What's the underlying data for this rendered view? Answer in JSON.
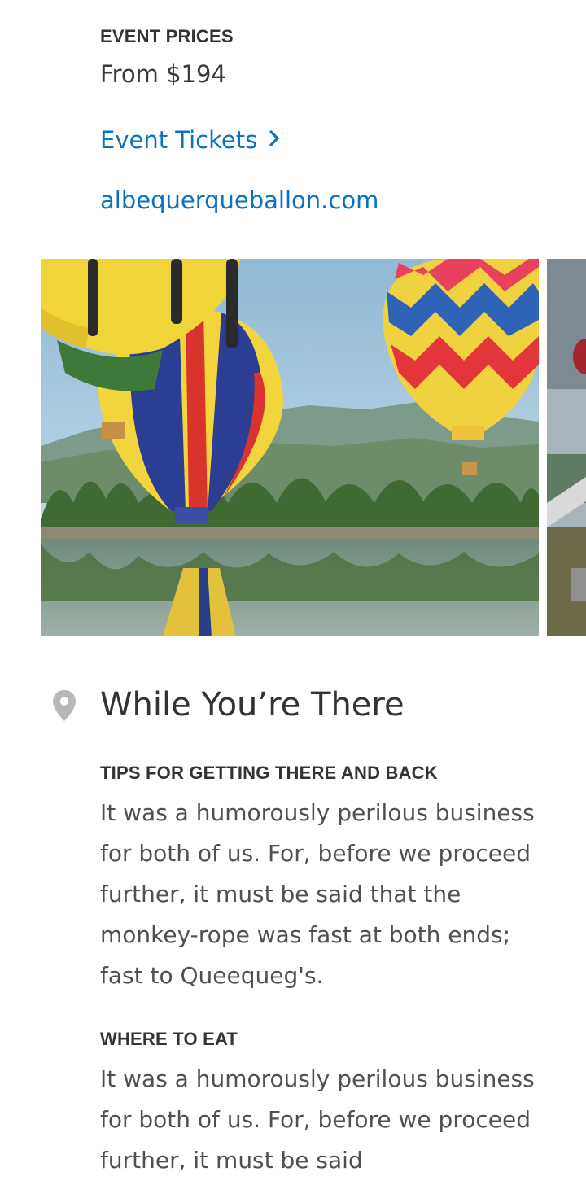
{
  "event": {
    "prices_label": "EVENT PRICES",
    "price_value": "From $194",
    "tickets_link": "Event Tickets",
    "website_link": "albequerqueballon.com"
  },
  "gallery": {
    "main_photo": "hot-air-balloons-over-lake",
    "next_photo": "hot-air-balloon-city"
  },
  "while_there": {
    "title": "While You’re There",
    "sections": [
      {
        "heading": "TIPS FOR GETTING THERE AND BACK",
        "body": "It was a humorously perilous business for both of us. For, before we proceed further, it must be said that the monkey-rope was fast at both ends; fast to Queequeg's."
      },
      {
        "heading": "WHERE TO EAT",
        "body": "It was a humorously perilous business for both of us. For, before we proceed further, it must be said"
      }
    ]
  },
  "colors": {
    "link": "#0a72c0",
    "text": "#333333",
    "body_text": "#505050",
    "pin_icon": "#b8b8b8"
  }
}
